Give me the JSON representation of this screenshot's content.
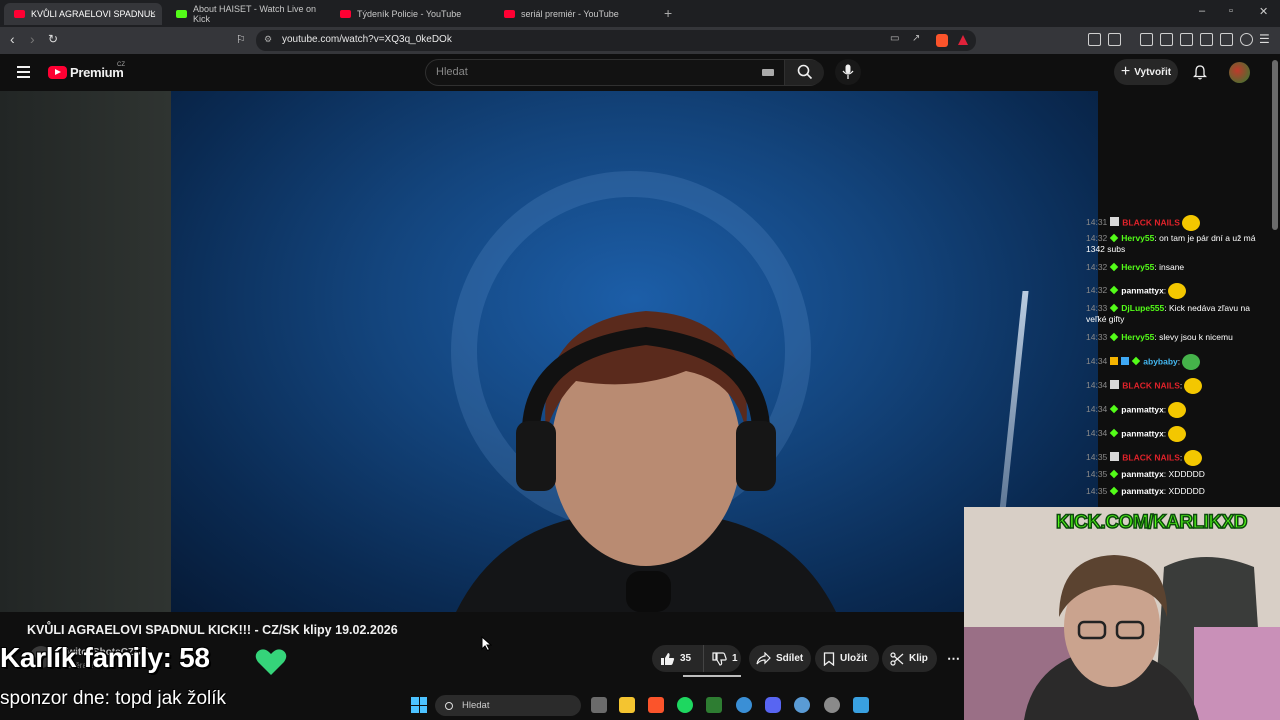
{
  "browser": {
    "tabs": [
      {
        "title": "KVŮLI AGRAELOVI SPADNUL",
        "favicon": "youtube-icon",
        "active": true
      },
      {
        "title": "About HAISET - Watch Live on Kick",
        "favicon": "kick-icon",
        "active": false
      },
      {
        "title": "Týdeník Policie - YouTube",
        "favicon": "youtube-icon",
        "active": false
      },
      {
        "title": "seriál premiér - YouTube",
        "favicon": "youtube-icon",
        "active": false
      }
    ],
    "new_tab": "+",
    "url": "youtube.com/watch?v=XQ3q_0keDOk"
  },
  "youtube": {
    "logo_text": "Premium",
    "country_code": "CZ",
    "search_placeholder": "Hledat",
    "create_label": "Vytvořit",
    "accent_red": "#ff0033"
  },
  "video": {
    "title": "KVŮLI AGRAELOVI SPADNUL KICK!!! - CZ/SK klipy 19.02.2026",
    "channel_name": "TwitchShotsCZSK",
    "channel_subs": "odběratelů",
    "likes": "35",
    "dislikes": "1",
    "share_label": "Sdílet",
    "save_label": "Uložit",
    "clip_label": "Klip",
    "more_label": "⋯"
  },
  "stream_overlay": {
    "family_text": "Karlík family: 58",
    "sponsor_text": "sponzor dne: topd jak žolík",
    "kick_banner": "KICK.COM/KARLIKXD",
    "kick_green": "#53fc18"
  },
  "chat": [
    {
      "time": "14:31",
      "user": "BLACK NAILS",
      "user_style": "red",
      "badge": "sq",
      "text": "",
      "emote": "yellow"
    },
    {
      "time": "14:32",
      "user": "Hervy55",
      "user_style": "green",
      "badge": "diamond",
      "text": ": on tam je pár dní a už má 1342 subs",
      "emote": ""
    },
    {
      "time": "14:32",
      "user": "Hervy55",
      "user_style": "green",
      "badge": "diamond",
      "text": ": insane",
      "emote": ""
    },
    {
      "time": "14:32",
      "user": "panmattyx",
      "user_style": "white",
      "badge": "diamond",
      "text": ":",
      "emote": "yellow"
    },
    {
      "time": "14:33",
      "user": "DjLupe555",
      "user_style": "green",
      "badge": "diamond",
      "text": ": Kick nedáva zľavu na veľké gifty",
      "emote": ""
    },
    {
      "time": "14:33",
      "user": "Hervy55",
      "user_style": "green",
      "badge": "diamond",
      "text": ": slevy jsou k nicemu",
      "emote": ""
    },
    {
      "time": "14:34",
      "user": "abybaby",
      "user_style": "cyan",
      "badge": "gold",
      "text": ":",
      "emote": "green"
    },
    {
      "time": "14:34",
      "user": "BLACK NAILS",
      "user_style": "red",
      "badge": "sq",
      "text": ":",
      "emote": "yellow"
    },
    {
      "time": "14:34",
      "user": "panmattyx",
      "user_style": "white",
      "badge": "diamond",
      "text": ":",
      "emote": "yellow"
    },
    {
      "time": "14:34",
      "user": "panmattyx",
      "user_style": "white",
      "badge": "diamond",
      "text": ":",
      "emote": "yellow"
    },
    {
      "time": "14:35",
      "user": "BLACK NAILS",
      "user_style": "red",
      "badge": "sq",
      "text": ":",
      "emote": "yellow"
    },
    {
      "time": "14:35",
      "user": "panmattyx",
      "user_style": "white",
      "badge": "diamond",
      "text": ": XDDDDD",
      "emote": ""
    },
    {
      "time": "14:35",
      "user": "panmattyx",
      "user_style": "white",
      "badge": "diamond",
      "text": ": XDDDDD",
      "emote": ""
    }
  ],
  "taskbar": {
    "search_label": "Hledat",
    "apps": [
      "task-view-icon",
      "file-explorer-icon",
      "brave-icon",
      "spotify-icon",
      "app-icon",
      "edge-icon",
      "discord-icon",
      "browser-icon",
      "settings-icon",
      "photos-icon"
    ]
  }
}
